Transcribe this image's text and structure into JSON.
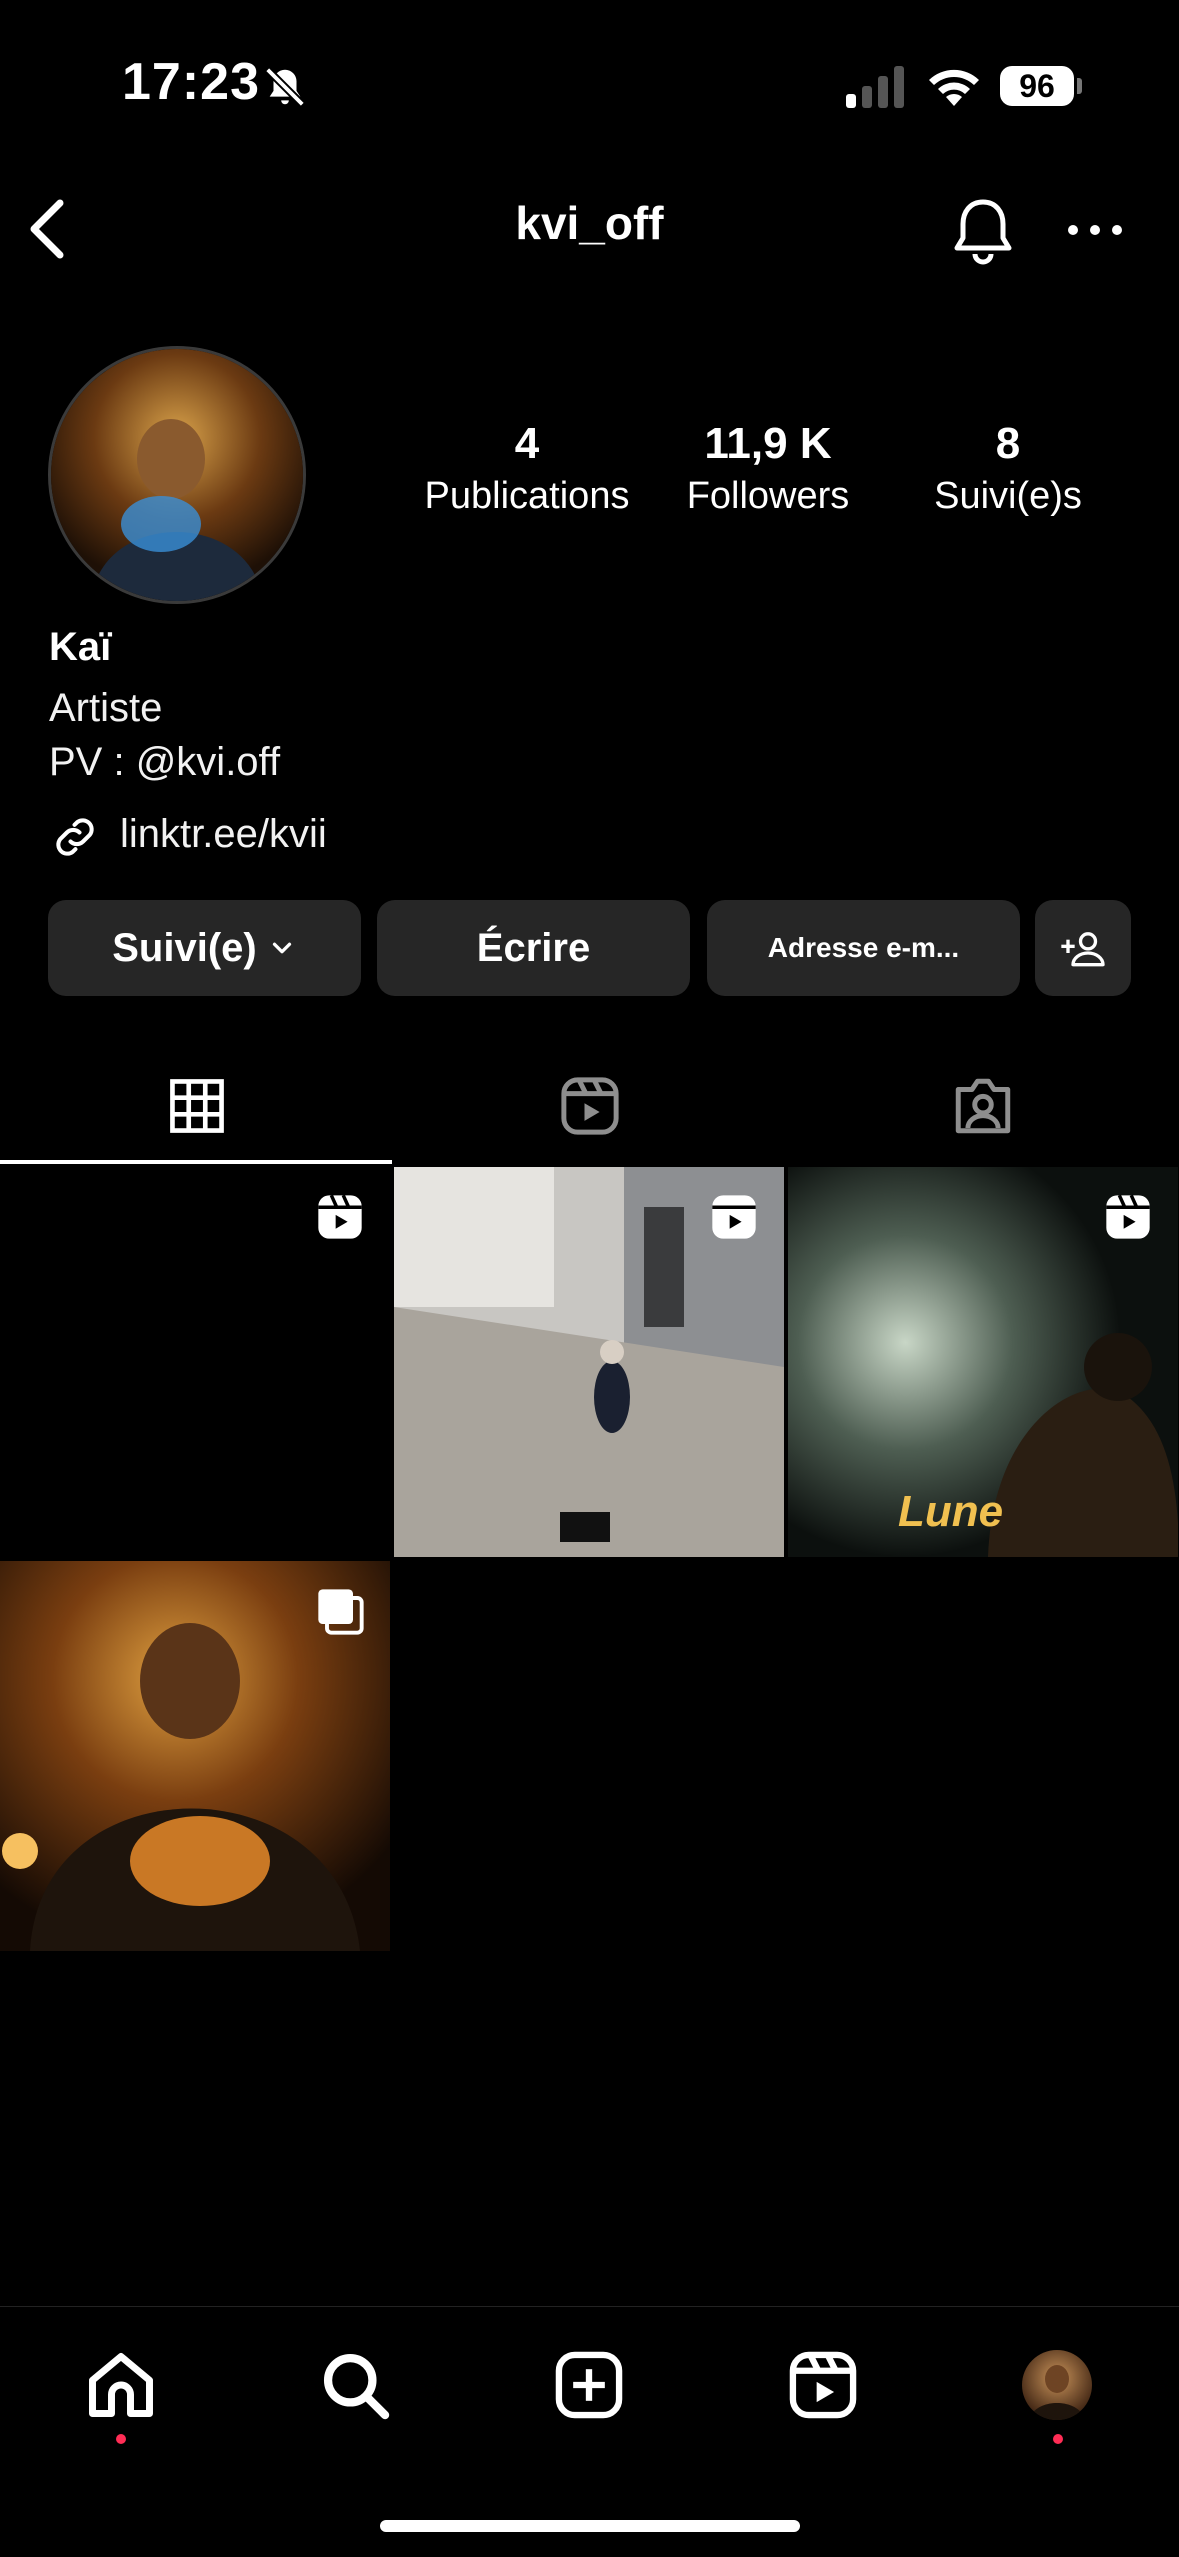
{
  "status_bar": {
    "time": "17:23",
    "battery": "96"
  },
  "header": {
    "username": "kvi_off"
  },
  "profile": {
    "stats": [
      {
        "value": "4",
        "label": "Publications"
      },
      {
        "value": "11,9 K",
        "label": "Followers"
      },
      {
        "value": "8",
        "label": "Suivi(e)s"
      }
    ],
    "display_name": "Kaï",
    "category": "Artiste",
    "bio": "PV : @kvi.off",
    "link": "linktr.ee/kvii"
  },
  "actions": {
    "followed": "Suivi(e)",
    "message": "Écrire",
    "email": "Adresse e-m..."
  },
  "grid": {
    "posts": [
      {
        "type": "reel",
        "caption": ""
      },
      {
        "type": "reel",
        "caption": ""
      },
      {
        "type": "reel",
        "caption": "Lune"
      },
      {
        "type": "carousel",
        "caption": ""
      }
    ]
  },
  "icons": [
    "back-icon",
    "bell-icon",
    "more-icon",
    "link-icon",
    "chevron-down-icon",
    "add-user-icon",
    "grid-icon",
    "reels-icon",
    "tagged-icon",
    "home-icon",
    "search-icon",
    "create-icon",
    "reels-icon",
    "profile-avatar"
  ],
  "colors": {
    "background": "#000000",
    "button": "#262626",
    "notification_dot": "#ff2d55"
  }
}
